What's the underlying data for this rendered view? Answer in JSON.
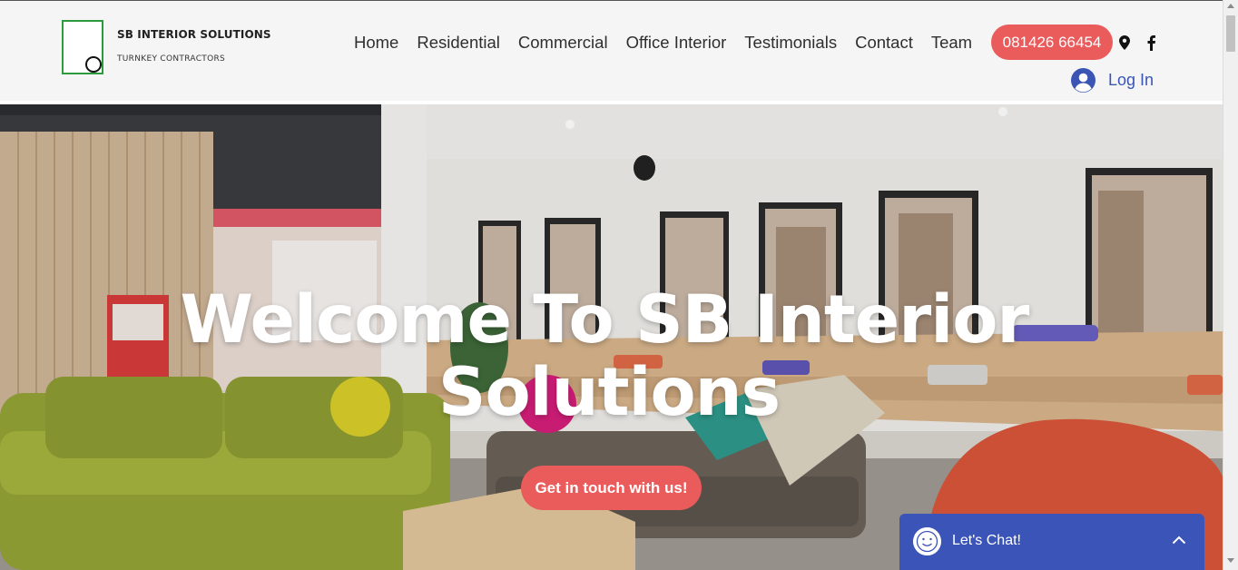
{
  "brand": {
    "name": "SB INTERIOR SOLUTIONS",
    "tagline": "TURNKEY CONTRACTORS",
    "logo_icon": "logo-square-circle-icon"
  },
  "nav": {
    "items": [
      {
        "label": "Home"
      },
      {
        "label": "Residential"
      },
      {
        "label": "Commercial"
      },
      {
        "label": "Office Interior"
      },
      {
        "label": "Testimonials"
      },
      {
        "label": "Contact"
      },
      {
        "label": "Team"
      }
    ],
    "phone": "081426 66454",
    "icons": [
      "map-pin-icon",
      "facebook-icon"
    ],
    "login_label": "Log In",
    "login_icon": "user-avatar-icon"
  },
  "hero": {
    "title_line1": "Welcome To SB Interior",
    "title_line2": "Solutions",
    "cta_label": "Get in touch with us!"
  },
  "chat": {
    "label": "Let's Chat!",
    "icon": "smiley-face-icon",
    "toggle_icon": "chevron-up-icon"
  },
  "colors": {
    "accent": "#ea5b5b",
    "link_blue": "#3a55b3",
    "chat_blue": "#3b54b8",
    "logo_green": "#2e9a3e",
    "header_bg": "#f5f5f5"
  }
}
